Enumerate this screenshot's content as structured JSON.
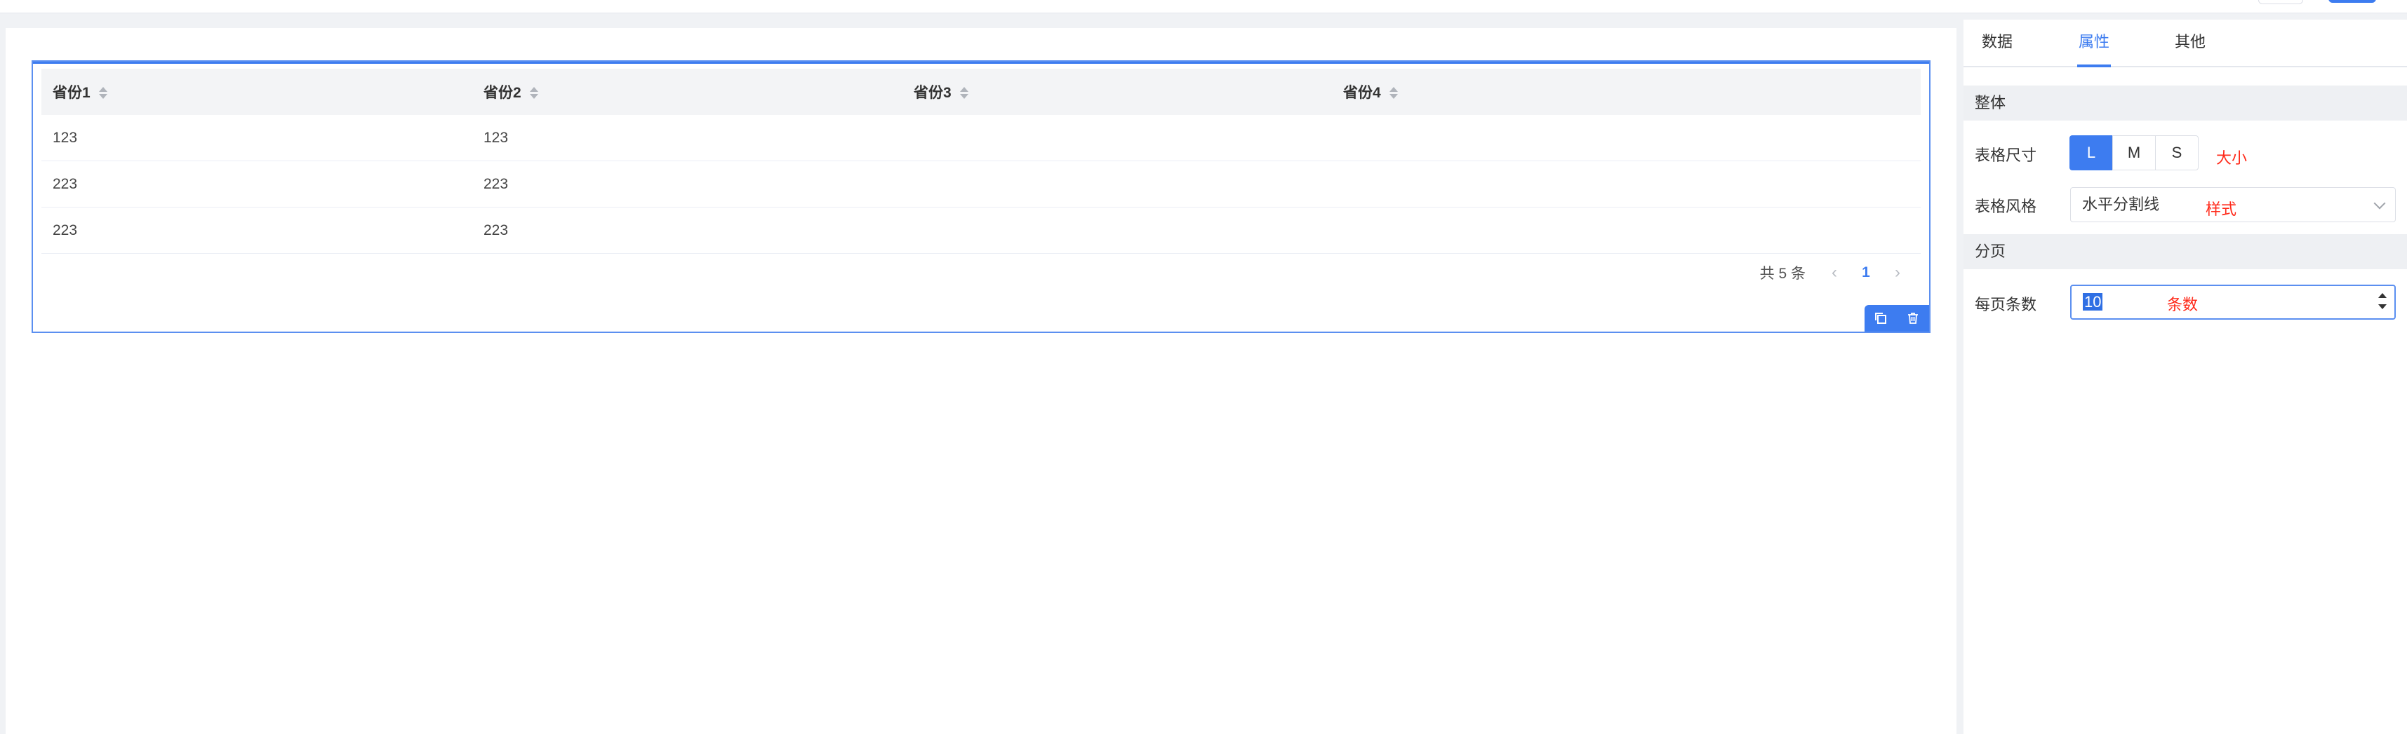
{
  "table": {
    "columns": [
      "省份1",
      "省份2",
      "省份3",
      "省份4"
    ],
    "rows": [
      [
        "123",
        "123",
        "",
        ""
      ],
      [
        "223",
        "223",
        "",
        ""
      ],
      [
        "223",
        "223",
        "",
        ""
      ]
    ],
    "pagination": {
      "total_text": "共 5 条",
      "current_page": "1",
      "prev": "‹",
      "next": "›"
    }
  },
  "panel": {
    "tabs": [
      "数据",
      "属性",
      "其他"
    ],
    "active_tab": "属性",
    "sections": {
      "overall": "整体",
      "pagination": "分页"
    },
    "size": {
      "label": "表格尺寸",
      "options": [
        "L",
        "M",
        "S"
      ],
      "selected": "L",
      "note": "大小"
    },
    "style": {
      "label": "表格风格",
      "value": "水平分割线",
      "note": "样式"
    },
    "page_size": {
      "label": "每页条数",
      "value": "10",
      "note": "条数"
    }
  },
  "colors": {
    "accent": "#3d7cf0",
    "annotation": "#ff2a1a",
    "section_bg": "#eef0f3"
  }
}
